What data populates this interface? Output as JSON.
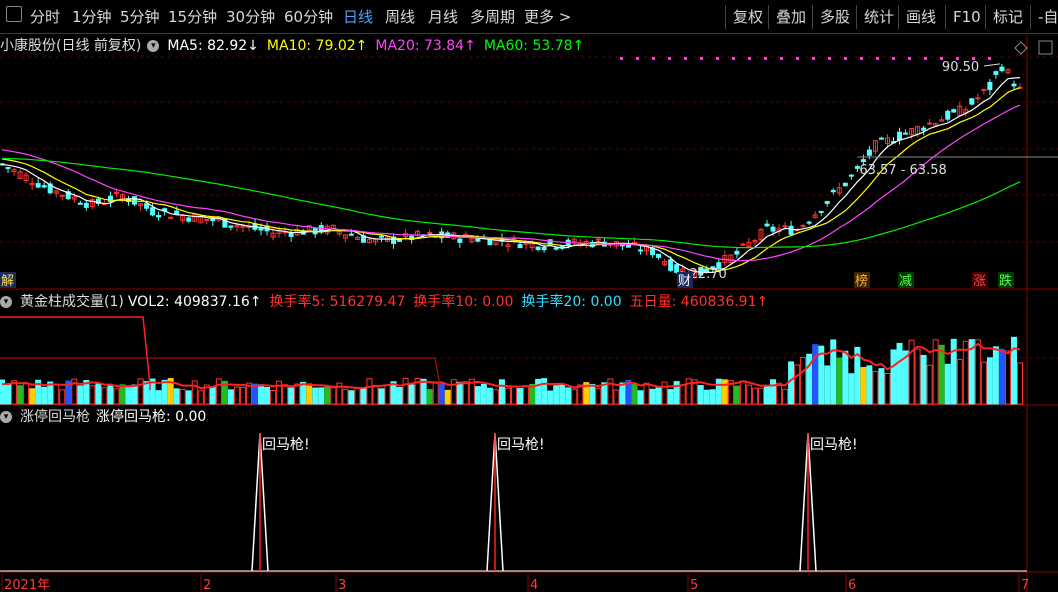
{
  "toolbar": {
    "left_items": [
      {
        "label": "分时"
      },
      {
        "label": "1分钟"
      },
      {
        "label": "5分钟"
      },
      {
        "label": "15分钟"
      },
      {
        "label": "30分钟"
      },
      {
        "label": "60分钟"
      },
      {
        "label": "日线",
        "active": true
      },
      {
        "label": "周线"
      },
      {
        "label": "月线"
      },
      {
        "label": "多周期"
      },
      {
        "label": "更多 >"
      }
    ],
    "right_items": [
      {
        "label": "复权"
      },
      {
        "label": "叠加"
      },
      {
        "label": "多股"
      },
      {
        "label": "统计"
      },
      {
        "label": "画线"
      },
      {
        "label": "F10"
      },
      {
        "label": "标记"
      },
      {
        "label": "-自选"
      }
    ]
  },
  "kline_header": {
    "stock": "小康股份(日线 前复权)",
    "ma5": "MA5: 82.92↓",
    "ma10": "MA10: 79.02↑",
    "ma20": "MA20: 73.84↑",
    "ma60": "MA60: 53.78↑",
    "colors": {
      "ma5": "#ffffff",
      "ma10": "#ffff00",
      "ma20": "#ff44ff",
      "ma60": "#00ff00"
    }
  },
  "kline_annotations": {
    "high_label": "90.50",
    "low_label": "22.70",
    "range_label": "63.57 - 63.58",
    "badge_jie": "解",
    "badge_cai": "财",
    "badge_bang": "榜",
    "badge_jian": "减",
    "badge_zhang": "涨",
    "badge_die": "跌"
  },
  "vol_header": {
    "name": "黄金柱成交量(1)",
    "vol2": "VOL2: 409837.16↑",
    "hsl5": "换手率5: 516279.47",
    "hsl10": "换手率10: 0.00",
    "hsl20": "换手率20: 0.00",
    "wrl": "五日量: 460836.91↑"
  },
  "signal_header": {
    "name": "涨停回马枪",
    "value": "涨停回马枪: 0.00",
    "signal_label": "回马枪!"
  },
  "x_axis": {
    "labels": [
      "2021年",
      "2",
      "3",
      "4",
      "5",
      "6",
      "7"
    ]
  },
  "chart_data": {
    "type": "candlestick",
    "title": "小康股份(日线 前复权)",
    "period": "日线",
    "indicators": {
      "MA5": 82.92,
      "MA10": 79.02,
      "MA20": 73.84,
      "MA60": 53.78
    },
    "price_range": [
      22.7,
      90.5
    ],
    "annotated_high": 90.5,
    "annotated_low": 22.7,
    "x_ticks": [
      "2021年",
      "2",
      "3",
      "4",
      "5",
      "6",
      "7"
    ],
    "volume_indicator": {
      "VOL2": 409837.16,
      "换手率5": 516279.47,
      "换手率10": 0.0,
      "换手率20": 0.0,
      "五日量": 460836.91
    },
    "signal_indicator": {
      "name": "涨停回马枪",
      "value": 0.0,
      "signal_count": 3,
      "signal_label": "回马枪!"
    }
  }
}
